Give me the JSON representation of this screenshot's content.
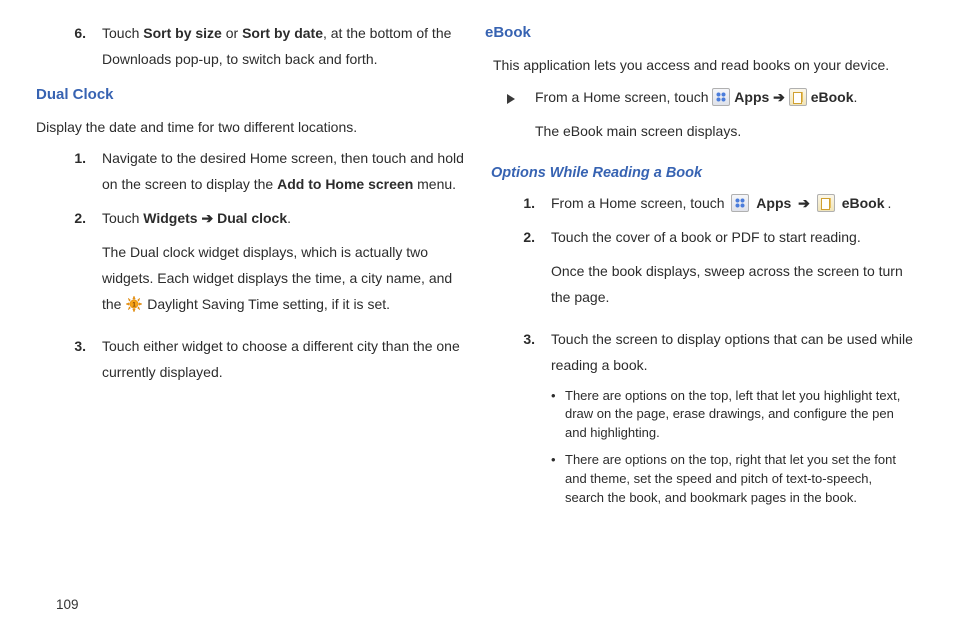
{
  "page_number": "109",
  "left": {
    "step6_before": "Touch ",
    "step6_s1": "Sort by size",
    "step6_mid": " or ",
    "step6_s2": "Sort by date",
    "step6_after": ", at the bottom of the Downloads pop-up, to switch back and forth.",
    "h_dualclock": "Dual Clock",
    "intro": "Display the date and time for two different locations.",
    "s1_a": "Navigate to the desired Home screen, then touch and hold on the screen to display the ",
    "s1_bold": "Add to Home screen",
    "s1_b": " menu.",
    "s2_pre": "Touch ",
    "s2_b1": "Widgets",
    "s2_arrow": " ➔ ",
    "s2_b2": "Dual clock",
    "s2_post": ".",
    "s2_p2a": "The Dual clock widget displays, which is actually two widgets. Each widget displays the time, a city name, and the ",
    "s2_p2b": " Daylight Saving Time setting, if it is set.",
    "s3": "Touch either widget to choose a different city than the one currently displayed."
  },
  "right": {
    "h_ebook": "eBook",
    "ebook_intro": "This application lets you access and read books on your device.",
    "fh_pre": "From a Home screen, touch ",
    "apps_label": "Apps",
    "seq_arrow": " ➔ ",
    "ebook_label": "eBook",
    "seq_post": ".",
    "ebook_p2": "The eBook main screen displays.",
    "h_options": "Options While Reading a Book",
    "o2": "Touch the cover of a book or PDF to start reading.",
    "o2b": "Once the book displays, sweep across the screen to turn the page.",
    "o3": "Touch the screen to display options that can be used while reading a book.",
    "b1": "There are options on the top, left that let you highlight text, draw on the page, erase drawings, and configure the pen and highlighting.",
    "b2": "There are options on the top, right that let you set the font and theme, set the speed and pitch of text-to-speech, search the book, and bookmark pages in the book."
  }
}
